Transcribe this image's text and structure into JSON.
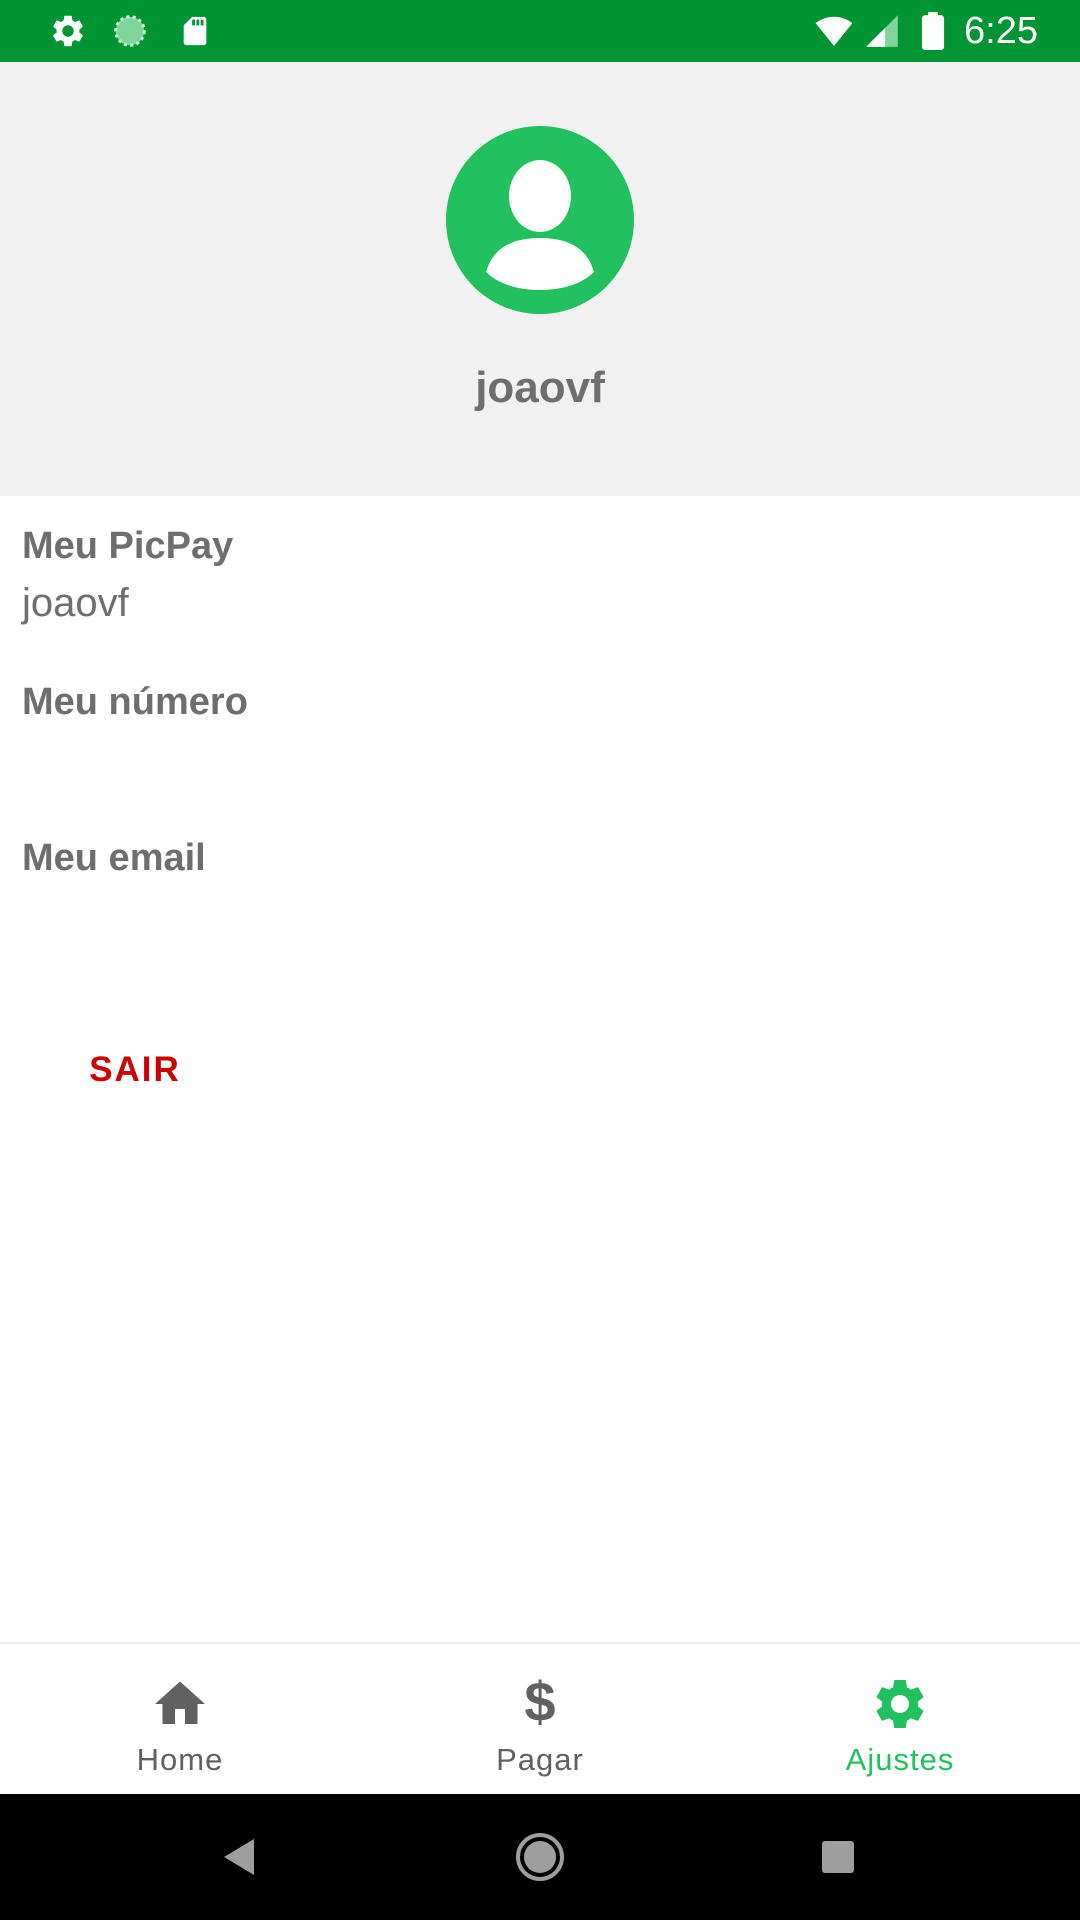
{
  "status_bar": {
    "time": "6:25",
    "icons": [
      "gear-icon",
      "sync-icon",
      "sd-card-icon",
      "wifi-icon",
      "signal-icon",
      "battery-icon"
    ],
    "background_color": "#009432"
  },
  "profile": {
    "username": "joaovf",
    "avatar_icon": "user-avatar-icon",
    "avatar_color": "#21c25e",
    "header_background": "#f1f1f1"
  },
  "info": {
    "picpay_label": "Meu PicPay",
    "picpay_value": "joaovf",
    "numero_label": "Meu número",
    "numero_value": "",
    "email_label": "Meu email",
    "email_value": ""
  },
  "logout": {
    "label": "SAIR",
    "color": "#cc0000"
  },
  "bottom_nav": {
    "items": [
      {
        "label": "Home",
        "icon": "home-icon",
        "active": false
      },
      {
        "label": "Pagar",
        "icon": "dollar-icon",
        "active": false
      },
      {
        "label": "Ajustes",
        "icon": "gear-icon",
        "active": true
      }
    ],
    "active_color": "#21c25e",
    "inactive_color": "#616161"
  },
  "system_nav": {
    "buttons": [
      "back-icon",
      "home-circle-icon",
      "recents-icon"
    ]
  }
}
